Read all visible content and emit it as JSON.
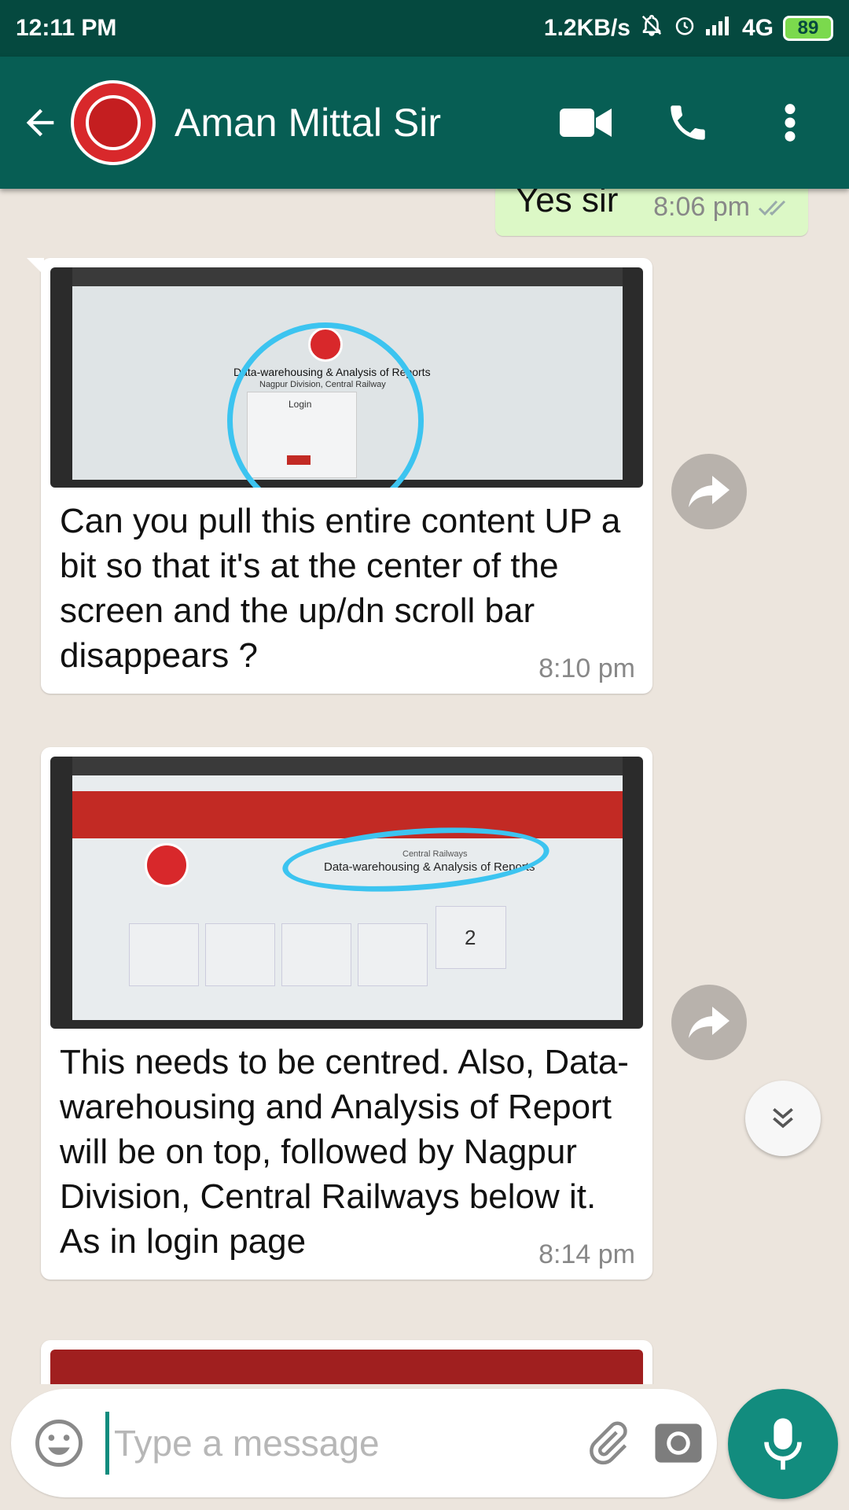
{
  "status_bar": {
    "time": "12:11 PM",
    "network_speed": "1.2KB/s",
    "network_type": "4G",
    "battery": "89"
  },
  "header": {
    "contact_name": "Aman Mittal Sir",
    "icons": [
      "back-arrow-icon",
      "video-call-icon",
      "phone-icon",
      "more-options-icon"
    ]
  },
  "messages": {
    "outgoing": {
      "text": "Yes sir",
      "time": "8:06 pm"
    },
    "incoming1": {
      "caption": "Can you pull this entire content UP a bit so that it's at the center of the screen and the up/dn scroll bar disappears ?",
      "time": "8:10 pm",
      "photo_title": "Data-warehousing & Analysis of Reports",
      "photo_subtitle": "Nagpur Division, Central Railway",
      "photo_login": "Login"
    },
    "incoming2": {
      "caption": "This needs to be centred. Also, Data-warehousing and Analysis of Report will be on top, followed by Nagpur Division, Central Railways below it. As in login page",
      "time": "8:14 pm",
      "photo_header_small": "Central Railways",
      "photo_header": "Data-warehousing & Analysis of Reports",
      "photo_stable_train": "2"
    }
  },
  "input": {
    "placeholder": "Type a message"
  },
  "colors": {
    "header_bg": "#075e54",
    "status_bg": "#05493f",
    "outgoing_bubble": "#dcf8c6",
    "accent": "#128c7e",
    "chat_bg": "#ece5dd"
  }
}
